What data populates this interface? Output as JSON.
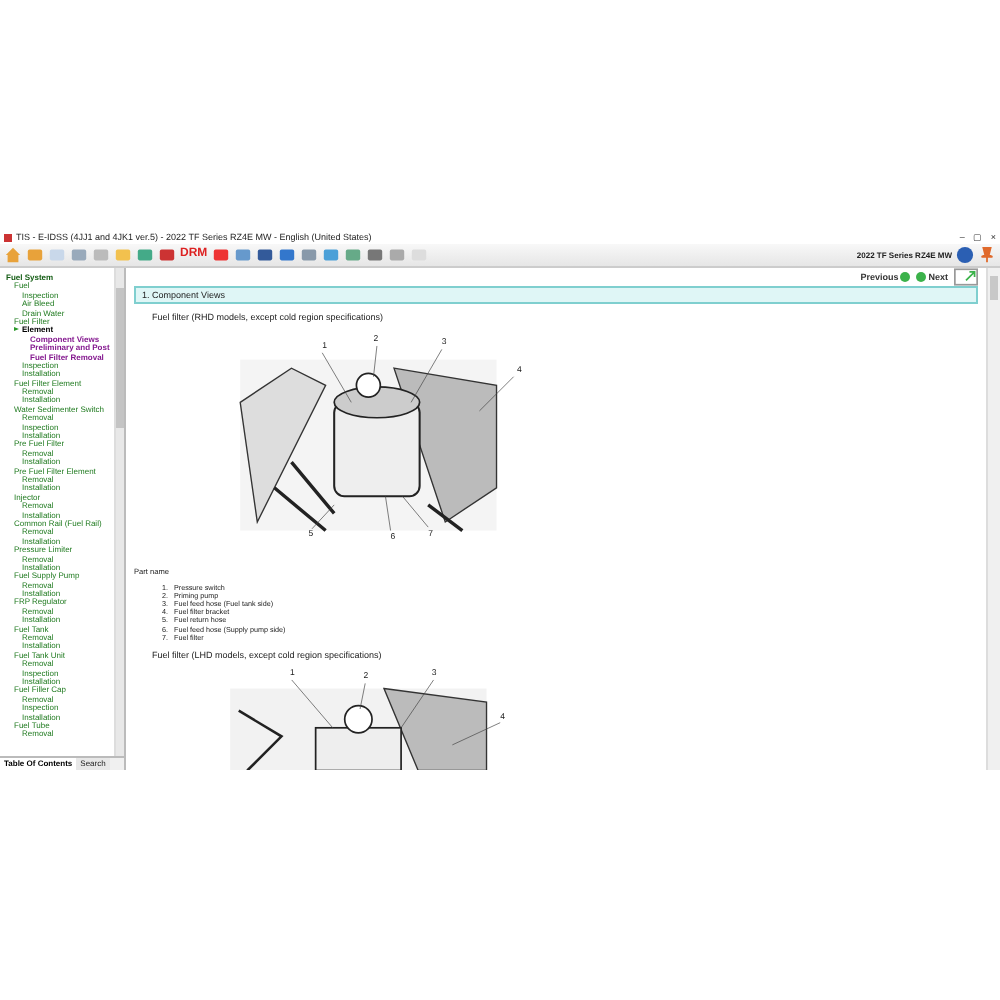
{
  "window": {
    "title": "TIS - E-IDSS (4JJ1 and 4JK1 ver.5) - 2022 TF Series RZ4E MW - English (United States)",
    "controls": [
      "–",
      "▢",
      "×"
    ]
  },
  "toolbar": {
    "drm_label": "DRM",
    "model": "2022 TF Series RZ4E MW"
  },
  "sidebar": {
    "tree": [
      {
        "label": "Fuel System",
        "kind": "root",
        "selected": false,
        "children": [
          {
            "label": "Fuel",
            "kind": "topic",
            "selected": false,
            "children": [
              {
                "label": "Inspection",
                "kind": "topic",
                "selected": false
              },
              {
                "label": "Air Bleed",
                "kind": "topic",
                "selected": false
              },
              {
                "label": "Drain Water",
                "kind": "topic",
                "selected": false
              }
            ]
          },
          {
            "label": "Fuel Filter",
            "kind": "topic",
            "selected": false,
            "children": [
              {
                "label": "Element",
                "kind": "topic",
                "selected": true,
                "children": [
                  {
                    "label": "Component Views",
                    "kind": "page",
                    "selected": false
                  },
                  {
                    "label": "Preliminary and Post",
                    "kind": "page",
                    "selected": false
                  },
                  {
                    "label": "Fuel Filter Removal",
                    "kind": "page",
                    "selected": false
                  }
                ]
              },
              {
                "label": "Inspection",
                "kind": "topic",
                "selected": false
              },
              {
                "label": "Installation",
                "kind": "topic",
                "selected": false
              }
            ]
          },
          {
            "label": "Fuel Filter Element",
            "kind": "topic",
            "selected": false,
            "children": [
              {
                "label": "Removal",
                "kind": "topic",
                "selected": false
              },
              {
                "label": "Installation",
                "kind": "topic",
                "selected": false
              }
            ]
          },
          {
            "label": "Water Sedimenter Switch",
            "kind": "topic",
            "selected": false,
            "children": [
              {
                "label": "Removal",
                "kind": "topic",
                "selected": false
              },
              {
                "label": "Inspection",
                "kind": "topic",
                "selected": false
              },
              {
                "label": "Installation",
                "kind": "topic",
                "selected": false
              }
            ]
          },
          {
            "label": "Pre Fuel Filter",
            "kind": "topic",
            "selected": false,
            "children": [
              {
                "label": "Removal",
                "kind": "topic",
                "selected": false
              },
              {
                "label": "Installation",
                "kind": "topic",
                "selected": false
              }
            ]
          },
          {
            "label": "Pre Fuel Filter Element",
            "kind": "topic",
            "selected": false,
            "children": [
              {
                "label": "Removal",
                "kind": "topic",
                "selected": false
              },
              {
                "label": "Installation",
                "kind": "topic",
                "selected": false
              }
            ]
          },
          {
            "label": "Injector",
            "kind": "topic",
            "selected": false,
            "children": [
              {
                "label": "Removal",
                "kind": "topic",
                "selected": false
              },
              {
                "label": "Installation",
                "kind": "topic",
                "selected": false
              }
            ]
          },
          {
            "label": "Common Rail (Fuel Rail)",
            "kind": "topic",
            "selected": false,
            "children": [
              {
                "label": "Removal",
                "kind": "topic",
                "selected": false
              },
              {
                "label": "Installation",
                "kind": "topic",
                "selected": false
              }
            ]
          },
          {
            "label": "Pressure Limiter",
            "kind": "topic",
            "selected": false,
            "children": [
              {
                "label": "Removal",
                "kind": "topic",
                "selected": false
              },
              {
                "label": "Installation",
                "kind": "topic",
                "selected": false
              }
            ]
          },
          {
            "label": "Fuel Supply Pump",
            "kind": "topic",
            "selected": false,
            "children": [
              {
                "label": "Removal",
                "kind": "topic",
                "selected": false
              },
              {
                "label": "Installation",
                "kind": "topic",
                "selected": false
              }
            ]
          },
          {
            "label": "FRP Regulator",
            "kind": "topic",
            "selected": false,
            "children": [
              {
                "label": "Removal",
                "kind": "topic",
                "selected": false
              },
              {
                "label": "Installation",
                "kind": "topic",
                "selected": false
              }
            ]
          },
          {
            "label": "Fuel Tank",
            "kind": "topic",
            "selected": false,
            "children": [
              {
                "label": "Removal",
                "kind": "topic",
                "selected": false
              },
              {
                "label": "Installation",
                "kind": "topic",
                "selected": false
              }
            ]
          },
          {
            "label": "Fuel Tank Unit",
            "kind": "topic",
            "selected": false,
            "children": [
              {
                "label": "Removal",
                "kind": "topic",
                "selected": false
              },
              {
                "label": "Inspection",
                "kind": "topic",
                "selected": false
              },
              {
                "label": "Installation",
                "kind": "topic",
                "selected": false
              }
            ]
          },
          {
            "label": "Fuel Filler Cap",
            "kind": "topic",
            "selected": false,
            "children": [
              {
                "label": "Removal",
                "kind": "topic",
                "selected": false
              },
              {
                "label": "Inspection",
                "kind": "topic",
                "selected": false
              },
              {
                "label": "Installation",
                "kind": "topic",
                "selected": false
              }
            ]
          },
          {
            "label": "Fuel Tube",
            "kind": "topic",
            "selected": false,
            "children": [
              {
                "label": "Removal",
                "kind": "topic",
                "selected": false
              }
            ]
          }
        ]
      }
    ],
    "tabs": [
      {
        "label": "Table Of Contents",
        "selected": true
      },
      {
        "label": "Search",
        "selected": false
      }
    ]
  },
  "nav": {
    "previous": "Previous",
    "next": "Next"
  },
  "section": {
    "title": "1. Component Views"
  },
  "figure_1": {
    "caption": "Fuel filter (RHD models, except cold region specifications)",
    "callouts": [
      "1",
      "2",
      "3",
      "4",
      "5",
      "6",
      "7"
    ]
  },
  "parts": {
    "heading": "Part name",
    "items": [
      {
        "number": "1.",
        "name": "Pressure switch"
      },
      {
        "number": "2.",
        "name": "Priming pump"
      },
      {
        "number": "3.",
        "name": "Fuel feed hose (Fuel tank side)"
      },
      {
        "number": "4.",
        "name": "Fuel filter bracket"
      },
      {
        "number": "5.",
        "name": "Fuel return hose"
      },
      {
        "number": "6.",
        "name": "Fuel feed hose (Supply pump side)"
      },
      {
        "number": "7.",
        "name": "Fuel filter"
      }
    ]
  },
  "figure_2": {
    "caption": "Fuel filter (LHD models, except cold region specifications)",
    "callouts": [
      "1",
      "2",
      "3",
      "4"
    ]
  }
}
